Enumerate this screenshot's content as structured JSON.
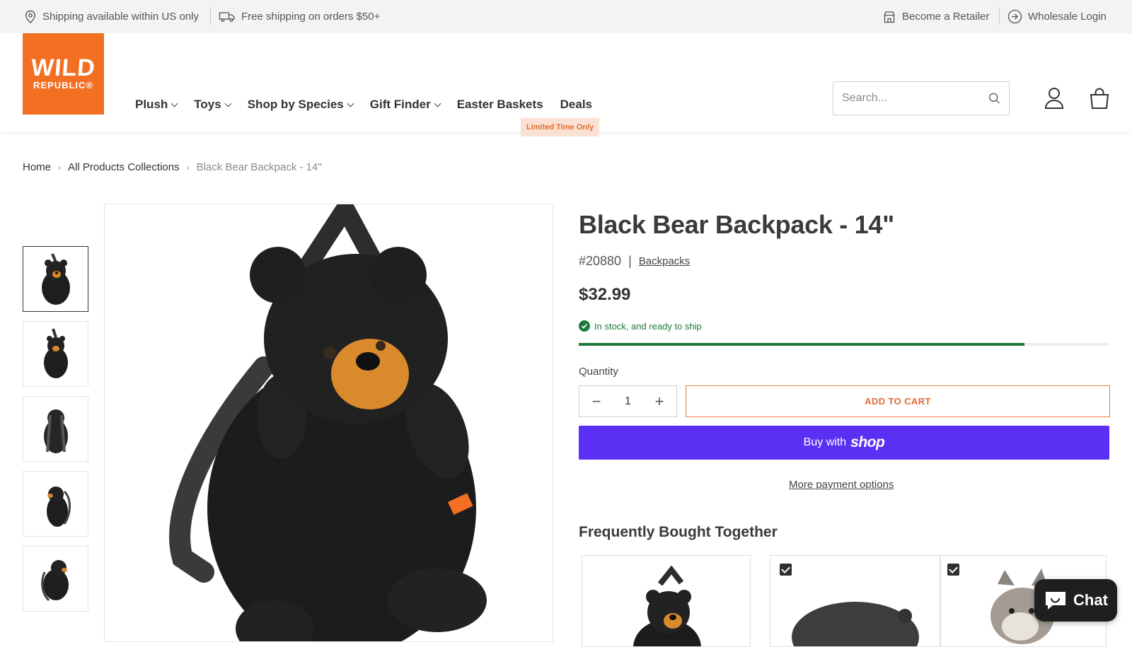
{
  "topbar": {
    "shipping_region": "Shipping available within US only",
    "free_shipping": "Free shipping on orders $50+",
    "retailer": "Become a Retailer",
    "wholesale": "Wholesale Login"
  },
  "logo": {
    "line1": "WILD",
    "line2": "REPUBLIC"
  },
  "nav": {
    "items": [
      {
        "label": "Plush",
        "dropdown": true
      },
      {
        "label": "Toys",
        "dropdown": true
      },
      {
        "label": "Shop by Species",
        "dropdown": true
      },
      {
        "label": "Gift Finder",
        "dropdown": true
      },
      {
        "label": "Easter Baskets",
        "dropdown": false
      },
      {
        "label": "Deals",
        "dropdown": false
      }
    ],
    "deals_badge": "Limited Time Only"
  },
  "search": {
    "placeholder": "Search..."
  },
  "breadcrumb": {
    "home": "Home",
    "collection": "All Products Collections",
    "current": "Black Bear Backpack - 14\""
  },
  "product": {
    "title": "Black Bear Backpack - 14\"",
    "sku": "#20880",
    "category": "Backpacks",
    "price": "$32.99",
    "stock_text": "In stock, and ready to ship",
    "stock_level": 0.84,
    "quantity_label": "Quantity",
    "quantity_value": "1",
    "add_to_cart": "ADD TO CART",
    "buy_with": "Buy with",
    "buy_brand": "shop",
    "more_payment": "More payment options"
  },
  "fbt": {
    "heading": "Frequently Bought Together"
  },
  "chat": {
    "label": "Chat"
  },
  "colors": {
    "brand_orange": "#f36f21",
    "shop_purple": "#5a31f4",
    "stock_green": "#1d7a3c"
  }
}
